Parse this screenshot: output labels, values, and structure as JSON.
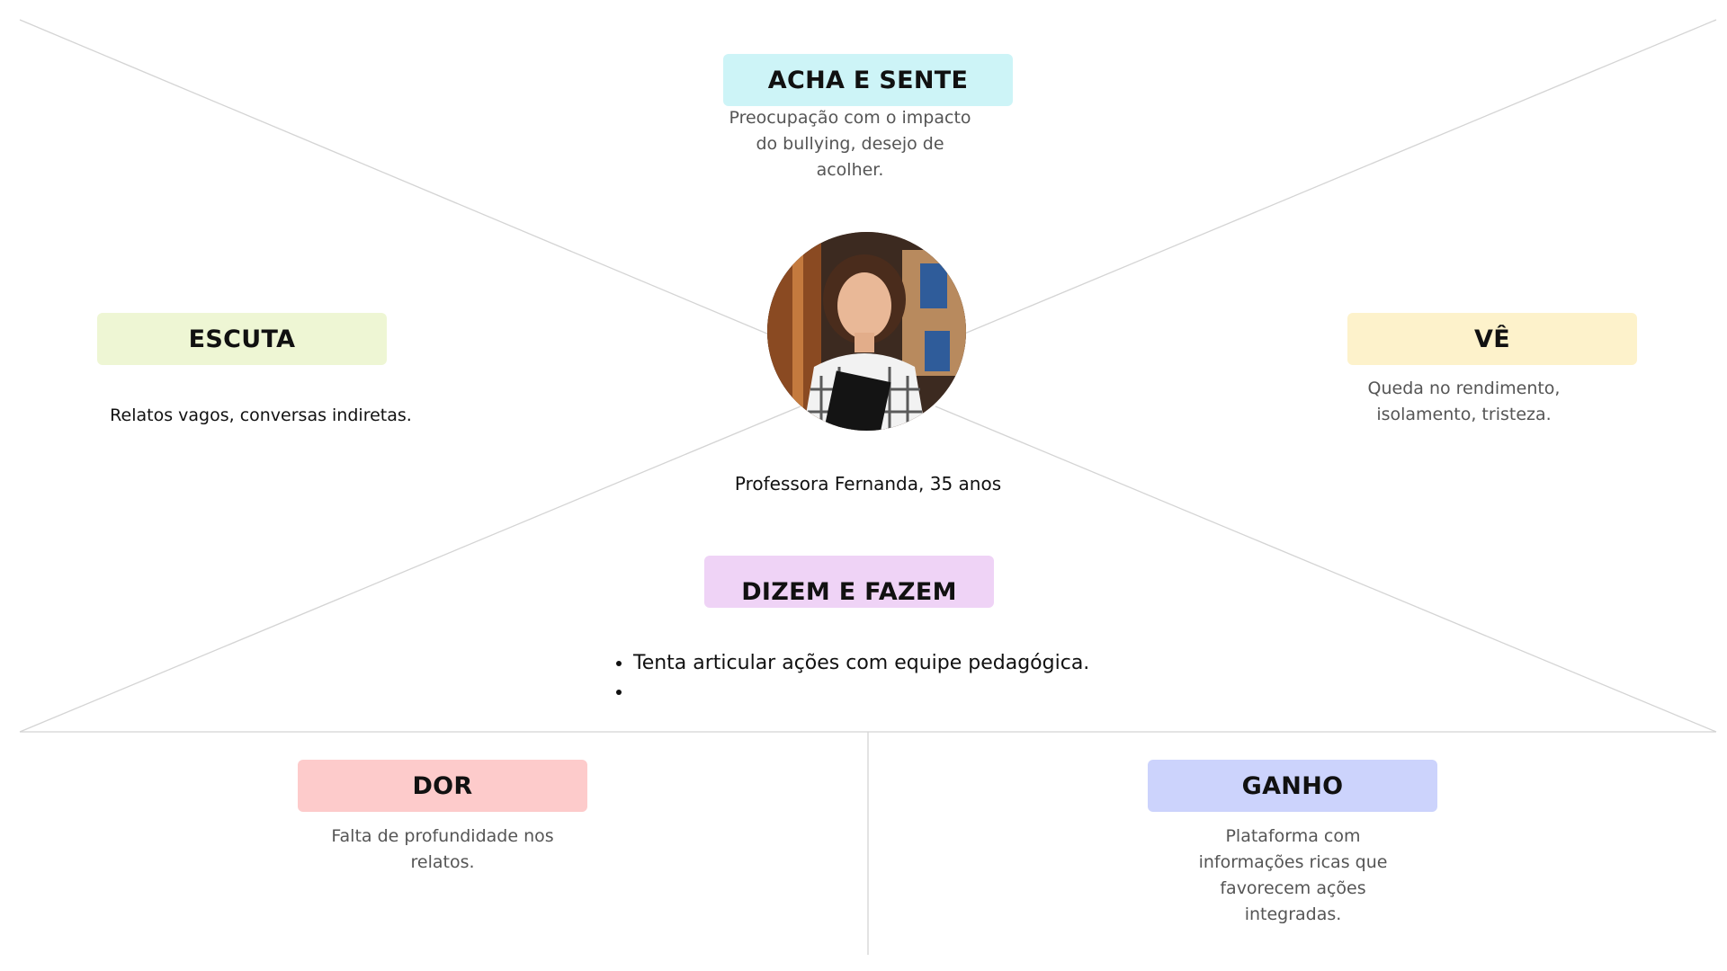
{
  "persona": {
    "name": "Professora Fernanda, 35 anos",
    "photo_alt": "avatar"
  },
  "quadrants": {
    "thinks_feels": {
      "title": "ACHA E SENTE",
      "text": "Preocupação com o impacto do bullying, desejo de acolher.",
      "color": "#cdf4f7"
    },
    "hears": {
      "title": "ESCUTA",
      "text": "Relatos vagos, conversas indiretas.",
      "color": "#eef6d4"
    },
    "sees": {
      "title": "VÊ",
      "text": "Queda no rendimento, isolamento, tristeza.",
      "color": "#fdf2cb"
    },
    "says_does": {
      "title": "DIZEM E FAZEM",
      "items": [
        "Tenta articular ações com equipe pedagógica.",
        ""
      ],
      "color": "#efd3f6"
    },
    "pain": {
      "title": "DOR",
      "text": "Falta de profundidade nos relatos.",
      "color": "#fdcbcb"
    },
    "gain": {
      "title": "GANHO",
      "text": "Plataforma com informações ricas que favorecem ações integradas.",
      "color": "#ccd3fc"
    }
  },
  "colors": {
    "divider": "#d4d4d4",
    "muted_text": "#555555"
  }
}
